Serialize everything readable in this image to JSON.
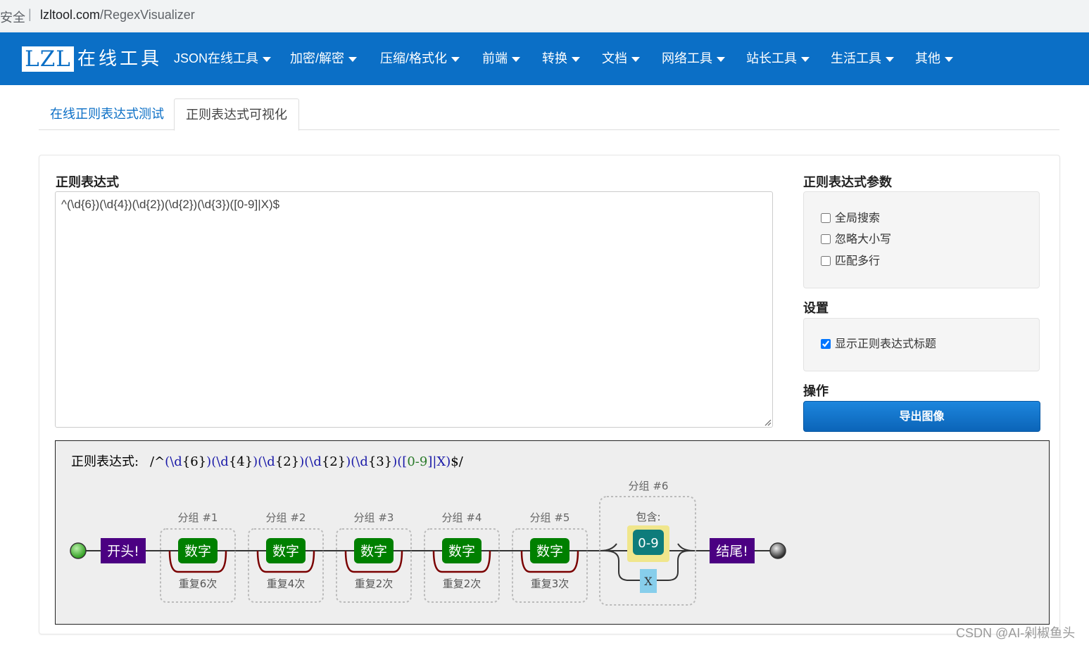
{
  "browser": {
    "security_label": "安全",
    "separator": "|",
    "url_host": "lzltool.com",
    "url_path": "/RegexVisualizer"
  },
  "navbar": {
    "logo": "LZL",
    "logo_text": "在线工具",
    "items": [
      {
        "label": "JSON在线工具"
      },
      {
        "label": "加密/解密"
      },
      {
        "label": "压缩/格式化"
      },
      {
        "label": "前端"
      },
      {
        "label": "转换"
      },
      {
        "label": "文档"
      },
      {
        "label": "网络工具"
      },
      {
        "label": "站长工具"
      },
      {
        "label": "生活工具"
      },
      {
        "label": "其他"
      }
    ],
    "bg_color": "#0b6fc6"
  },
  "tabs": [
    {
      "label": "在线正则表达式测试",
      "active": false
    },
    {
      "label": "正则表达式可视化",
      "active": true
    }
  ],
  "editor": {
    "label": "正则表达式",
    "value": "^(\\d{6})(\\d{4})(\\d{2})(\\d{2})(\\d{3})([0-9]|X)$"
  },
  "params": {
    "label": "正则表达式参数",
    "options": [
      {
        "label": "全局搜索",
        "checked": false
      },
      {
        "label": "忽略大小写",
        "checked": false
      },
      {
        "label": "匹配多行",
        "checked": false
      }
    ]
  },
  "settings": {
    "label": "设置",
    "options": [
      {
        "label": "显示正则表达式标题",
        "checked": true
      }
    ]
  },
  "actions": {
    "label": "操作",
    "export_label": "导出图像"
  },
  "visualization": {
    "title_prefix": "正则表达式:",
    "title_tokens": [
      {
        "text": "/",
        "color": "#000000"
      },
      {
        "text": "^",
        "color": "#000000"
      },
      {
        "text": "(",
        "color": "#1a1aa8"
      },
      {
        "text": "\\d",
        "color": "#1a1aa8"
      },
      {
        "text": "{6}",
        "color": "#000000"
      },
      {
        "text": ")",
        "color": "#1a1aa8"
      },
      {
        "text": "(",
        "color": "#1a1aa8"
      },
      {
        "text": "\\d",
        "color": "#1a1aa8"
      },
      {
        "text": "{4}",
        "color": "#000000"
      },
      {
        "text": ")",
        "color": "#1a1aa8"
      },
      {
        "text": "(",
        "color": "#1a1aa8"
      },
      {
        "text": "\\d",
        "color": "#1a1aa8"
      },
      {
        "text": "{2}",
        "color": "#000000"
      },
      {
        "text": ")",
        "color": "#1a1aa8"
      },
      {
        "text": "(",
        "color": "#1a1aa8"
      },
      {
        "text": "\\d",
        "color": "#1a1aa8"
      },
      {
        "text": "{2}",
        "color": "#000000"
      },
      {
        "text": ")",
        "color": "#1a1aa8"
      },
      {
        "text": "(",
        "color": "#1a1aa8"
      },
      {
        "text": "\\d",
        "color": "#1a1aa8"
      },
      {
        "text": "{3}",
        "color": "#000000"
      },
      {
        "text": ")",
        "color": "#1a1aa8"
      },
      {
        "text": "(",
        "color": "#1a1aa8"
      },
      {
        "text": "[",
        "color": "#1a1aa8"
      },
      {
        "text": "0-9",
        "color": "#2a7a2a"
      },
      {
        "text": "]",
        "color": "#1a1aa8"
      },
      {
        "text": "|",
        "color": "#1a1aa8"
      },
      {
        "text": "X",
        "color": "#1a1aa8"
      },
      {
        "text": ")",
        "color": "#1a1aa8"
      },
      {
        "text": "$",
        "color": "#000000"
      },
      {
        "text": "/",
        "color": "#000000"
      }
    ],
    "start_label": "开头!",
    "end_label": "结尾!",
    "groups": [
      {
        "label": "分组 #1",
        "node": "数字",
        "repeat": "重复6次"
      },
      {
        "label": "分组 #2",
        "node": "数字",
        "repeat": "重复4次"
      },
      {
        "label": "分组 #3",
        "node": "数字",
        "repeat": "重复2次"
      },
      {
        "label": "分组 #4",
        "node": "数字",
        "repeat": "重复2次"
      },
      {
        "label": "分组 #5",
        "node": "数字",
        "repeat": "重复3次"
      }
    ],
    "last_group": {
      "label": "分组 #6",
      "contains_label": "包含:",
      "range_label": "0-9",
      "alt_label": "X"
    },
    "colors": {
      "anchor": "#4b0082",
      "digit": "#008000",
      "repeat_loop": "#7a0000",
      "range_bg": "#f0e68c",
      "range_node": "#0e7c7b",
      "alt_node": "#87ceeb"
    }
  },
  "watermark": "CSDN @AI-剁椒鱼头"
}
